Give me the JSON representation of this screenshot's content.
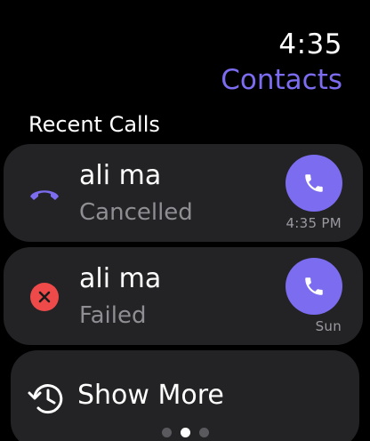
{
  "status_bar": {
    "time": "4:35"
  },
  "header": {
    "title": "Contacts",
    "accent_color": "#7b6cf0"
  },
  "section": {
    "title": "Recent Calls"
  },
  "recent_calls": [
    {
      "name": "ali ma",
      "status": "Cancelled",
      "time": "4:35 PM",
      "status_icon": "phone-down-icon",
      "action_icon": "phone-icon"
    },
    {
      "name": "ali ma",
      "status": "Failed",
      "time": "Sun",
      "status_icon": "x-circle-icon",
      "action_icon": "phone-icon"
    }
  ],
  "show_more": {
    "label": "Show More",
    "icon": "history-icon"
  },
  "pager": {
    "current_page": 2,
    "page_count": 3
  },
  "colors": {
    "background": "#000000",
    "card": "#232325",
    "accent": "#7b6cf0",
    "failed": "#ee4a4a",
    "secondary_text": "#8e8e93"
  }
}
